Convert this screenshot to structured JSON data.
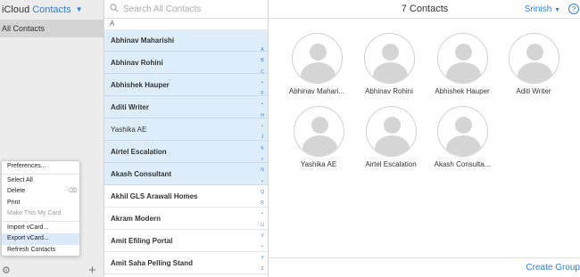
{
  "header": {
    "brand": "iCloud",
    "app": "Contacts"
  },
  "sidebar": {
    "group_all": "All Contacts"
  },
  "menu": {
    "items": [
      {
        "label": "Preferences..."
      },
      {
        "label": "Select All"
      },
      {
        "label": "Delete",
        "shortcut": "⌫"
      },
      {
        "label": "Print"
      },
      {
        "label": "Make This My Card"
      },
      {
        "label": "Import vCard..."
      },
      {
        "label": "Export vCard..."
      },
      {
        "label": "Refresh Contacts"
      }
    ]
  },
  "search": {
    "placeholder": "Search All Contacts"
  },
  "list": {
    "section": "A",
    "rows": [
      "Abhinav Maharishi",
      "Abhinav Rohini",
      "Abhishek Hauper",
      "Aditi Writer",
      "Yashika AE",
      "Airtel Escalation",
      "Akash Consultant",
      "Akhil GLS Arawali Homes",
      "Akram Modern",
      "Amit Efiling Portal",
      "Amit Saha Pelling Stand"
    ],
    "alphabet": [
      "A",
      "B",
      "C",
      "•",
      "F",
      "•",
      "H",
      "•",
      "J",
      "K",
      "•",
      "N",
      "•",
      "Q",
      "R",
      "•",
      "U",
      "V",
      "•",
      "Y",
      "Z",
      "#"
    ]
  },
  "main": {
    "count": "7 Contacts",
    "user": "Srinish",
    "help": "?",
    "cards": [
      "Abhinav Mahari...",
      "Abhinav Rohini",
      "Abhishek Hauper",
      "Aditi Writer",
      "Yashika AE",
      "Airtel Escalation",
      "Akash Consulta..."
    ],
    "create_group": "Create Group"
  },
  "colors": {
    "accent": "#2f7de1",
    "selection": "#ddeefa"
  }
}
